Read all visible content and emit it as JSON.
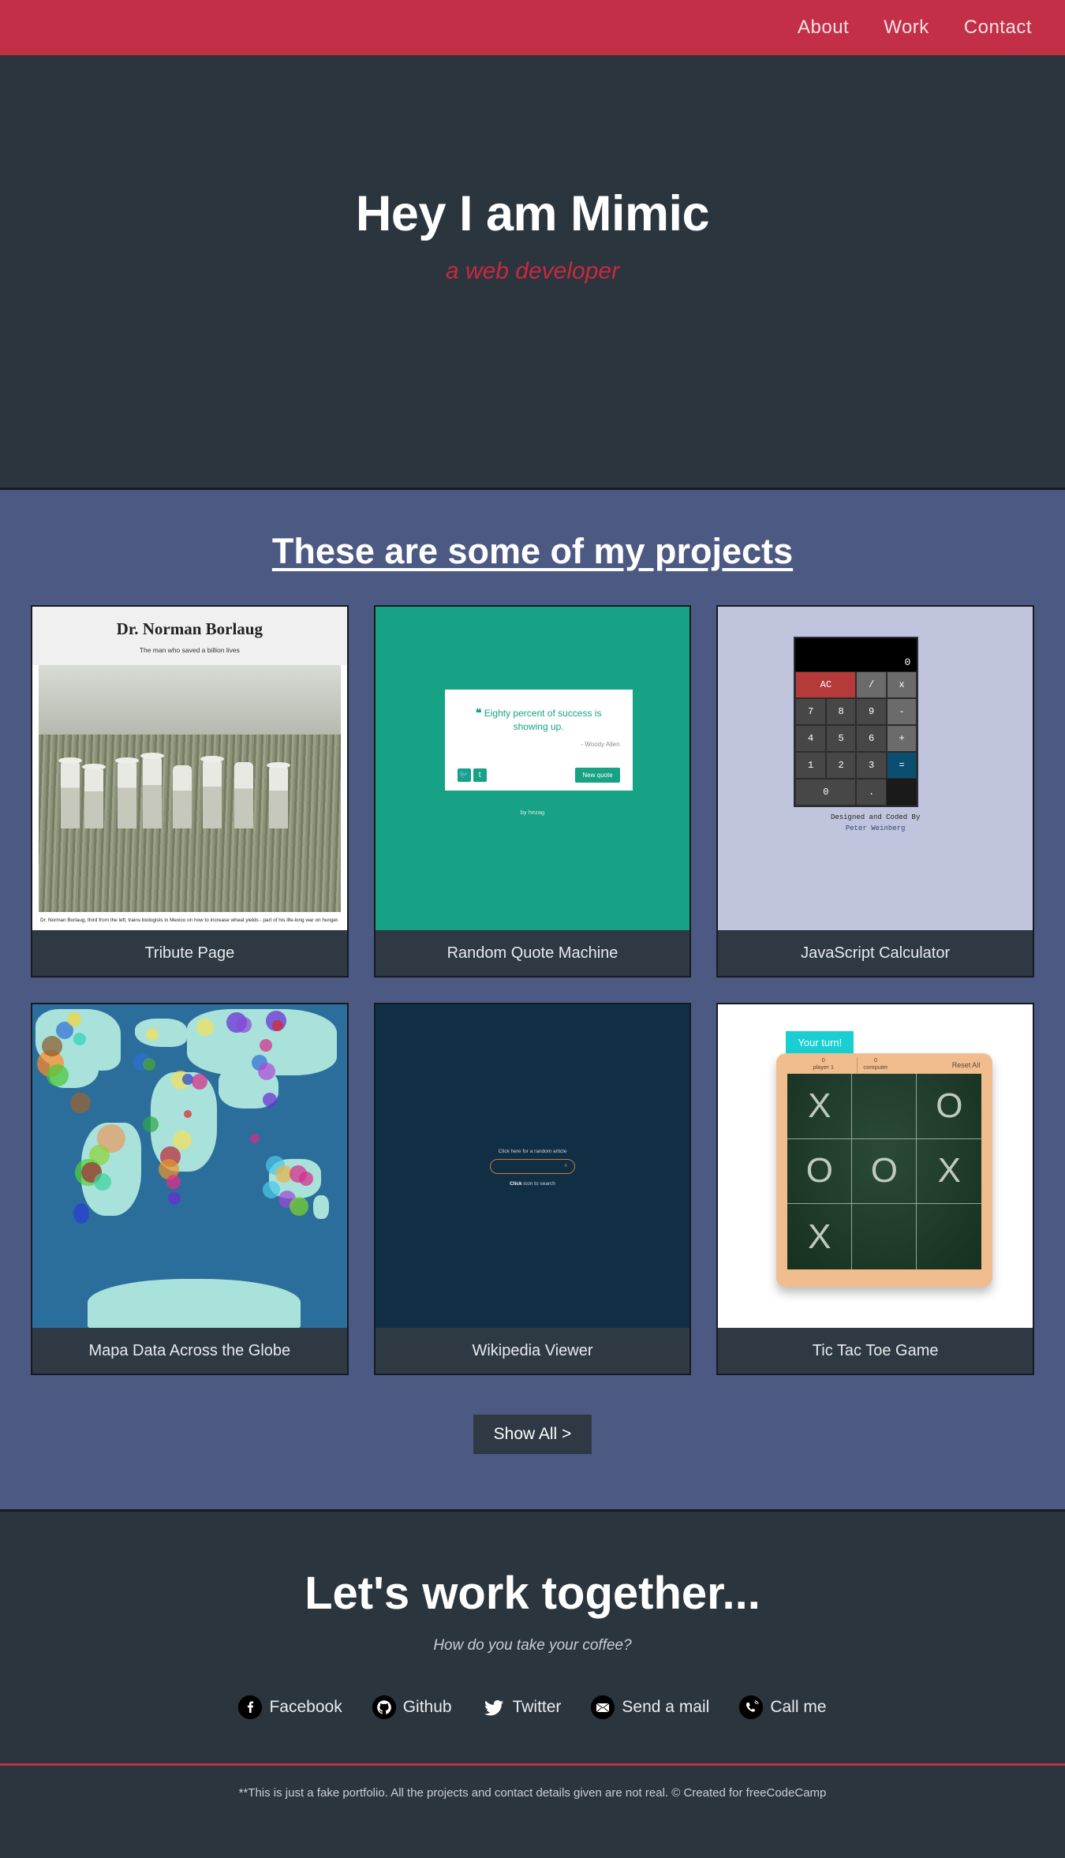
{
  "nav": {
    "links": [
      {
        "label": "About"
      },
      {
        "label": "Work"
      },
      {
        "label": "Contact"
      }
    ]
  },
  "hero": {
    "title": "Hey I am Mimic",
    "subtitle": "a web developer"
  },
  "projects": {
    "heading": "These are some of my projects",
    "show_all_label": "Show All >",
    "items": [
      {
        "label": "Tribute Page"
      },
      {
        "label": "Random Quote Machine"
      },
      {
        "label": "JavaScript Calculator"
      },
      {
        "label": "Mapa Data Across the Globe"
      },
      {
        "label": "Wikipedia Viewer"
      },
      {
        "label": "Tic Tac Toe Game"
      }
    ],
    "tribute": {
      "title": "Dr. Norman Borlaug",
      "subtitle": "The man who saved a billion lives",
      "caption": "Dr. Norman Borlaug, third from the left, trains biologists in Mexico on how to increase wheat yields - part of his life-long war on hunger."
    },
    "quote": {
      "text": "Eighty percent of success is showing up.",
      "mark": "❝",
      "author": "- Woody Allen",
      "twitter_glyph": "🐦",
      "tumblr_glyph": "t",
      "new_quote_label": "New quote",
      "credit": "by hezag"
    },
    "calculator": {
      "display": "0",
      "keys": [
        "AC",
        "/",
        "x",
        "7",
        "8",
        "9",
        "-",
        "4",
        "5",
        "6",
        "+",
        "1",
        "2",
        "3",
        "=",
        "0",
        "."
      ],
      "credit_line1": "Designed and Coded By",
      "credit_line2": "Peter Weinberg"
    },
    "wikipedia": {
      "top_text": "Click here for a random article",
      "clear_glyph": "x",
      "bottom_text_bold": "Click",
      "bottom_text": " icon to search"
    },
    "tictactoe": {
      "banner": "Your turn!",
      "player1_score": "0",
      "player1_label": "player 1",
      "computer_score": "0",
      "computer_label": "computer",
      "reset_label": "Reset All",
      "board": [
        "X",
        "",
        "O",
        "O",
        "O",
        "X",
        "X",
        "",
        ""
      ]
    }
  },
  "contact": {
    "title": "Let's work together...",
    "coffee": "How do you take your coffee?",
    "socials": [
      {
        "label": "Facebook",
        "glyph": "f"
      },
      {
        "label": "Github",
        "glyph": "●"
      },
      {
        "label": "Twitter",
        "glyph": "🐦"
      },
      {
        "label": "Send a mail",
        "glyph": "✉"
      },
      {
        "label": "Call me",
        "glyph": "☎"
      }
    ]
  },
  "footer": {
    "text": "**This is just a fake portfolio. All the projects and contact details given are not real.   © Created for freeCodeCamp"
  },
  "colors": {
    "navbar": "#c32f46",
    "hero_bg": "#2b353e",
    "projects_bg": "#4c5a83",
    "accent_red": "#c9293f",
    "card_label_bg": "#2f3943"
  }
}
